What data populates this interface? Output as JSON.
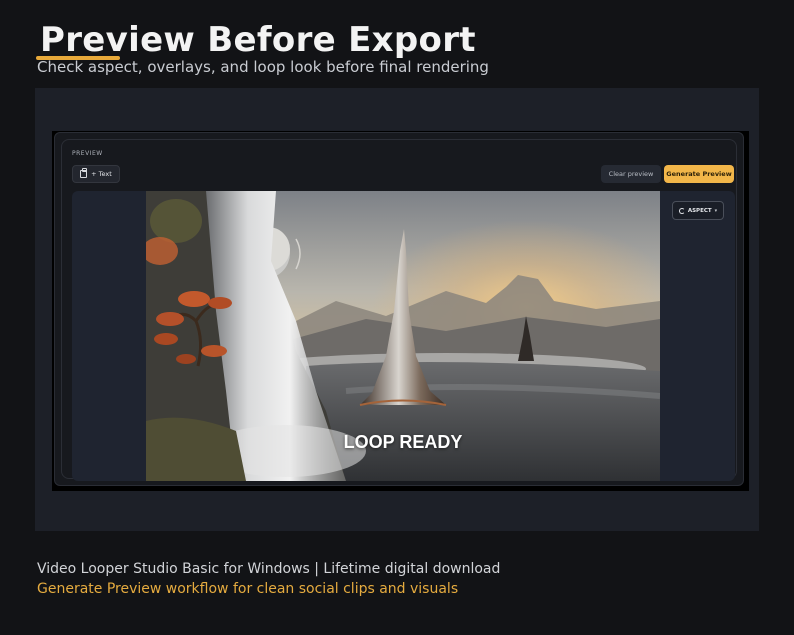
{
  "header": {
    "title": "Preview Before Export",
    "subtitle": "Check aspect, overlays, and loop look before final rendering"
  },
  "app": {
    "section_label": "PREVIEW",
    "toolbar": {
      "add_text_label": "+ Text",
      "clear_label": "Clear preview",
      "generate_label": "Generate Preview"
    },
    "canvas": {
      "overlay_text": "LOOP READY",
      "aspect_label": "ASPECT",
      "caret": "▾"
    }
  },
  "footer": {
    "product_line": "Video Looper Studio Basic for Windows  |  Lifetime digital download",
    "tagline": "Generate Preview workflow for clean social clips and visuals"
  },
  "colors": {
    "accent": "#f2b649",
    "tagline": "#e5ab3f",
    "background": "#121316"
  }
}
